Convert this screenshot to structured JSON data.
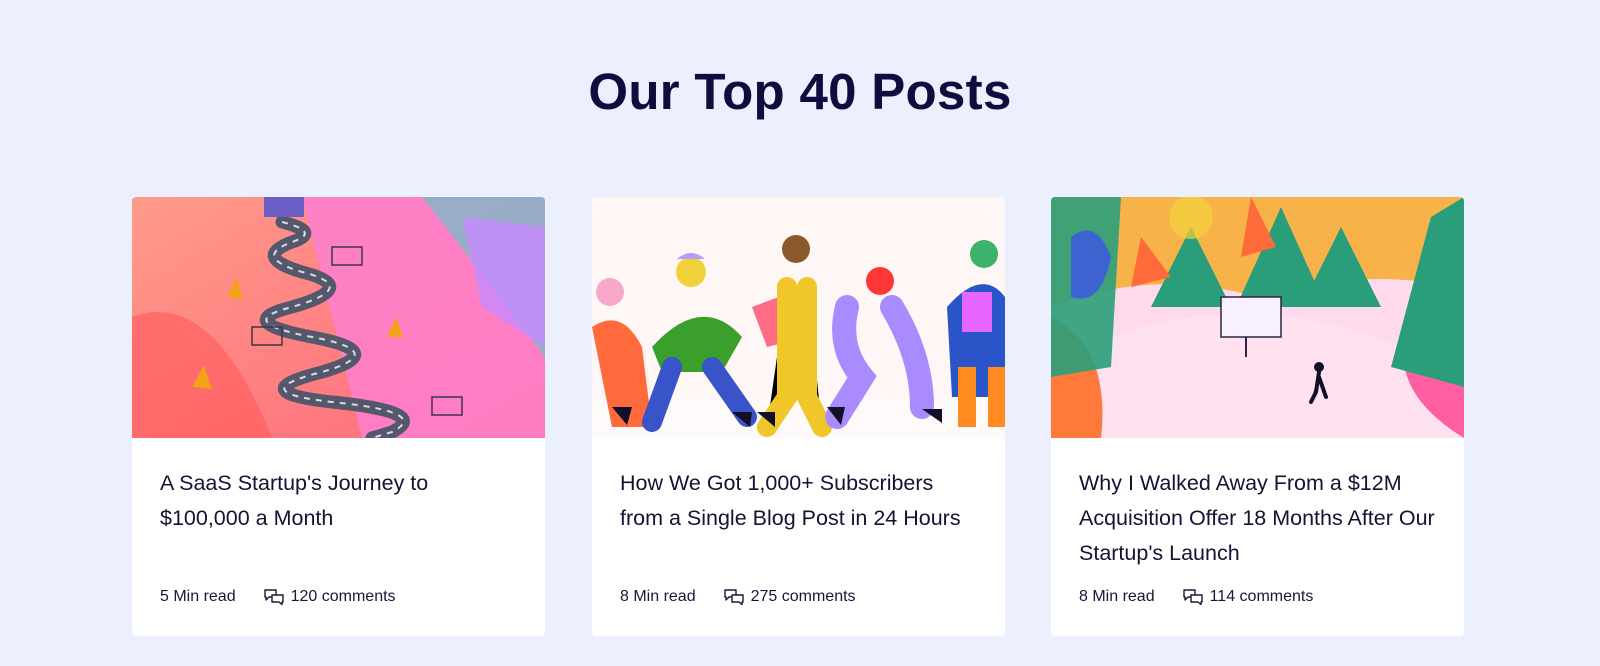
{
  "section_title": "Our Top 40 Posts",
  "posts": [
    {
      "title": "A SaaS Startup's Journey to $100,000 a Month",
      "read_time": "5 Min read",
      "comments": "120 comments",
      "image_icon": "winding-road-mountain-illustration"
    },
    {
      "title": "How We Got 1,000+ Subscribers from a Single Blog Post in 24 Hours",
      "read_time": "8 Min read",
      "comments": "275 comments",
      "image_icon": "walking-people-illustration"
    },
    {
      "title": "Why I Walked Away From a $12M Acquisition Offer 18 Months After Our Startup's Launch",
      "read_time": "8 Min read",
      "comments": "114 comments",
      "image_icon": "forest-walker-illustration"
    }
  ],
  "colors": {
    "background": "#eceffe",
    "heading": "#120b3d",
    "card": "#ffffff",
    "text": "#161233"
  }
}
